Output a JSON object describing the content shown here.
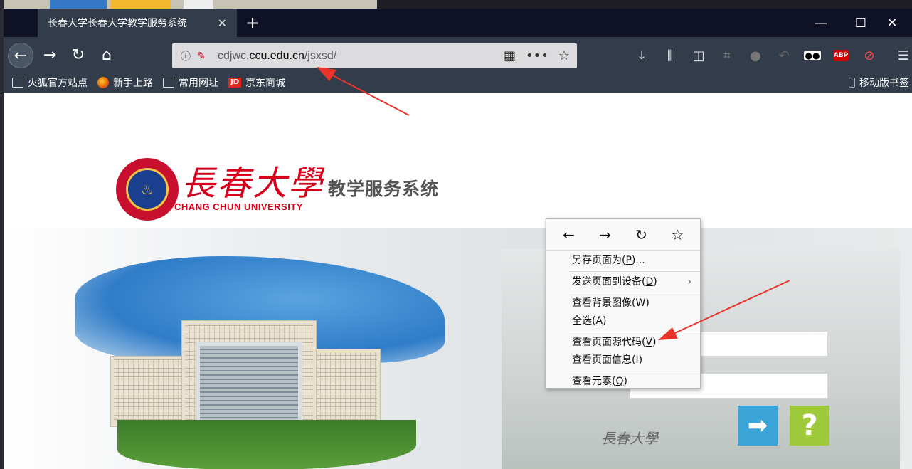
{
  "tab": {
    "title": "长春大学长春大学教学服务系统",
    "close": "✕",
    "new": "+"
  },
  "window_controls": {
    "minimize": "—",
    "maximize": "☐",
    "close": "✕"
  },
  "nav": {
    "back": "←",
    "forward": "→",
    "reload": "↻",
    "home": "⌂"
  },
  "url": {
    "prefix": "cdjwc.",
    "domain": "ccu.edu.cn",
    "path": "/jsxsd/",
    "menu": "•••",
    "star": "☆"
  },
  "toolbar_icons": [
    "download-icon",
    "library-icon",
    "sidebar-icon",
    "screenshot-icon",
    "chat-icon",
    "undo-icon",
    "extension-icon",
    "adblock-icon",
    "block-icon",
    "menu-icon"
  ],
  "bookmarks": [
    {
      "label": "火狐官方站点",
      "icon": "folder"
    },
    {
      "label": "新手上路",
      "icon": "firefox"
    },
    {
      "label": "常用网址",
      "icon": "folder"
    },
    {
      "label": "京东商城",
      "icon": "jd"
    }
  ],
  "mobile_bookmarks": "移动版书签",
  "site": {
    "brand_cn": "長春大學",
    "brand_en": "CHANG CHUN UNIVERSITY",
    "system_name": "教学服务系统",
    "logo_text": "CHANGCHUN UNIVERSITY",
    "sign": "長春大學"
  },
  "context_menu": {
    "nav": [
      "←",
      "→",
      "↻",
      "☆"
    ],
    "items": [
      {
        "text": "另存页面为(",
        "key": "P",
        "suffix": ")..."
      },
      {
        "text": "发送页面到设备(",
        "key": "D",
        "suffix": ")",
        "submenu": "›"
      },
      {
        "text": "查看背景图像(",
        "key": "W",
        "suffix": ")"
      },
      {
        "text": "全选(",
        "key": "A",
        "suffix": ")"
      },
      {
        "text": "查看页面源代码(",
        "key": "V",
        "suffix": ")"
      },
      {
        "text": "查看页面信息(",
        "key": "I",
        "suffix": ")"
      },
      {
        "text": "查看元素(",
        "key": "Q",
        "suffix": ")"
      }
    ]
  },
  "buttons": {
    "go": "➡",
    "help": "?"
  },
  "colors": {
    "chrome": "#323c4a",
    "tabbar": "#0f1126",
    "brand_red": "#d6001c",
    "go_blue": "#3aa3d8",
    "help_green": "#9ec93a",
    "arrow_red": "#e8342a"
  }
}
